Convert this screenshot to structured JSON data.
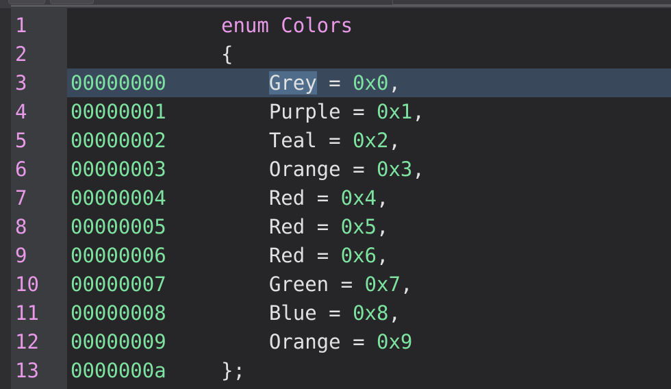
{
  "colors": {
    "line_number": "#e89ae8",
    "address": "#7ee3a0",
    "text": "#e2e2e2",
    "highlight_row": "#3a485b",
    "selection": "#4f6c8a"
  },
  "lines": [
    {
      "n": "1",
      "addr": "",
      "indent": "",
      "kw": "enum Colors",
      "name": "",
      "eq": "",
      "val": "",
      "tail": ""
    },
    {
      "n": "2",
      "addr": "",
      "indent": "",
      "kw": "",
      "name": "{",
      "eq": "",
      "val": "",
      "tail": ""
    },
    {
      "n": "3",
      "addr": "00000000",
      "indent": "    ",
      "kw": "",
      "name": "Grey",
      "eq": " = ",
      "val": "0x0",
      "tail": ","
    },
    {
      "n": "4",
      "addr": "00000001",
      "indent": "    ",
      "kw": "",
      "name": "Purple",
      "eq": " = ",
      "val": "0x1",
      "tail": ","
    },
    {
      "n": "5",
      "addr": "00000002",
      "indent": "    ",
      "kw": "",
      "name": "Teal",
      "eq": " = ",
      "val": "0x2",
      "tail": ","
    },
    {
      "n": "6",
      "addr": "00000003",
      "indent": "    ",
      "kw": "",
      "name": "Orange",
      "eq": " = ",
      "val": "0x3",
      "tail": ","
    },
    {
      "n": "7",
      "addr": "00000004",
      "indent": "    ",
      "kw": "",
      "name": "Red",
      "eq": " = ",
      "val": "0x4",
      "tail": ","
    },
    {
      "n": "8",
      "addr": "00000005",
      "indent": "    ",
      "kw": "",
      "name": "Red",
      "eq": " = ",
      "val": "0x5",
      "tail": ","
    },
    {
      "n": "9",
      "addr": "00000006",
      "indent": "    ",
      "kw": "",
      "name": "Red",
      "eq": " = ",
      "val": "0x6",
      "tail": ","
    },
    {
      "n": "10",
      "addr": "00000007",
      "indent": "    ",
      "kw": "",
      "name": "Green",
      "eq": " = ",
      "val": "0x7",
      "tail": ","
    },
    {
      "n": "11",
      "addr": "00000008",
      "indent": "    ",
      "kw": "",
      "name": "Blue",
      "eq": " = ",
      "val": "0x8",
      "tail": ","
    },
    {
      "n": "12",
      "addr": "00000009",
      "indent": "    ",
      "kw": "",
      "name": "Orange",
      "eq": " = ",
      "val": "0x9",
      "tail": ""
    },
    {
      "n": "13",
      "addr": "0000000a",
      "indent": "",
      "kw": "",
      "name": "};",
      "eq": "",
      "val": "",
      "tail": ""
    }
  ],
  "highlighted_line": "3",
  "selected_text": "Grey"
}
